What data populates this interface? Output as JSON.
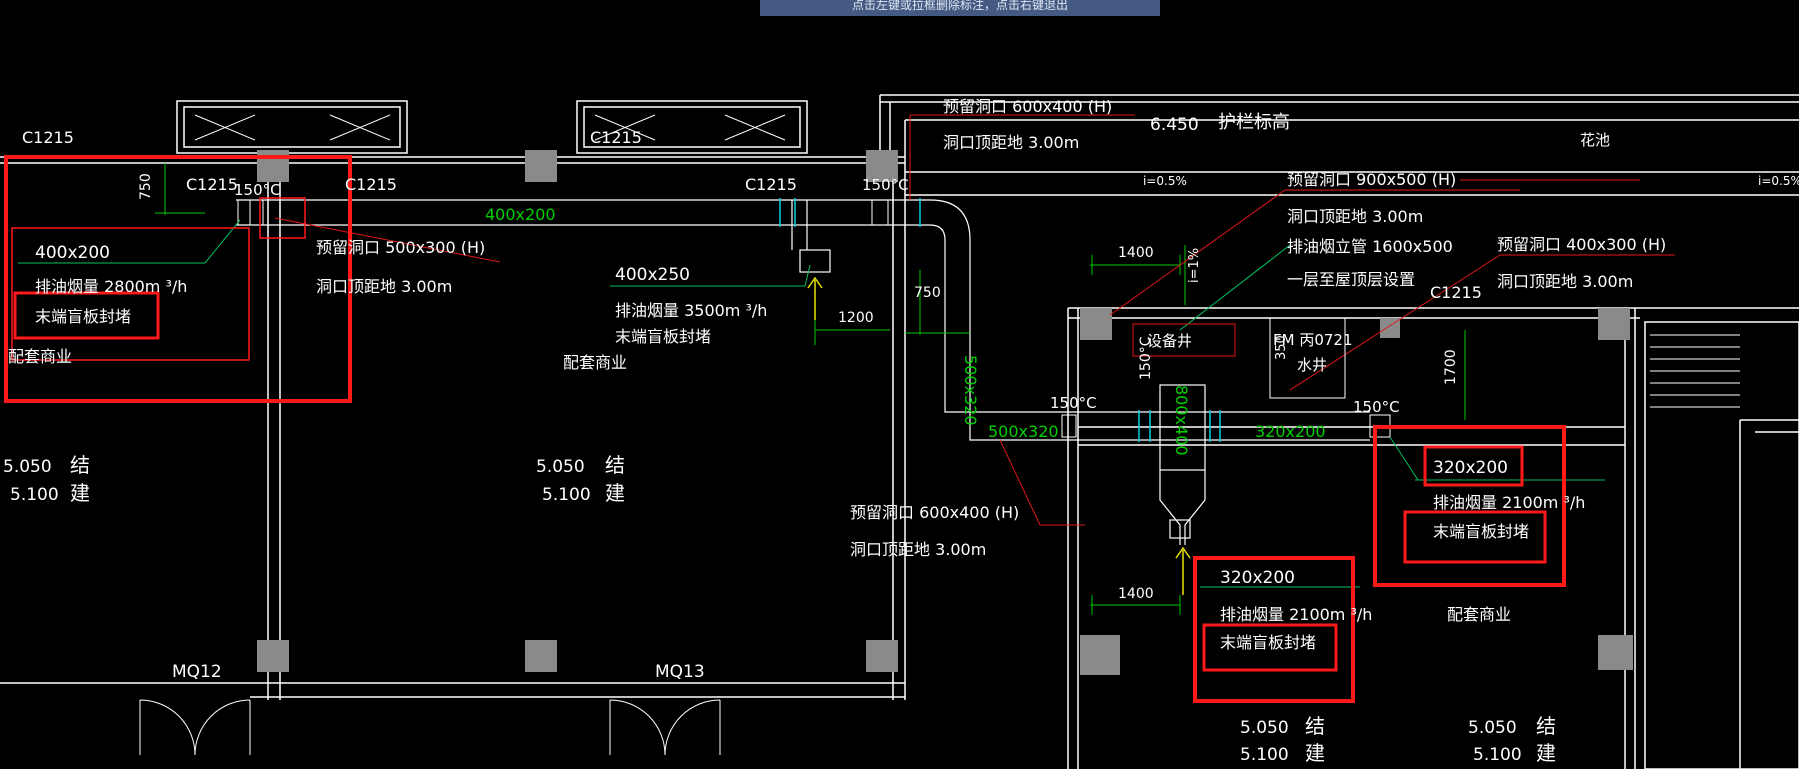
{
  "tooltip": "点击左键或拉框删除标注，点击右键退出",
  "colors": {
    "bg": "#000000",
    "line": "#ffffff",
    "dim": "#00c800",
    "highlight": "#ff0000",
    "grey_col": "#8a8a8a",
    "leader_red": "#e01818",
    "leader_green": "#00c060",
    "yellow": "#e6e600"
  },
  "windows": [
    "C1215",
    "C1215",
    "C1215",
    "C1215",
    "C1215",
    "C1215"
  ],
  "doors": [
    "MQ12",
    "MQ13"
  ],
  "rooms": [
    "配套商业",
    "配套商业",
    "配套商业"
  ],
  "room_partial": "配套商业",
  "shaft": "设备井",
  "shaft2": "水井",
  "fm": "FM 丙0721",
  "elev": {
    "e1": "5.050",
    "e2": "5.100",
    "struct1": "结",
    "struct2": "建",
    "top": "6.450",
    "top_note": "护栏标高",
    "pool": "花池",
    "slope": "i=0.5%",
    "slope2": "i=1%"
  },
  "duct_labels": {
    "d1": "400x200",
    "d2": "500x320",
    "d3": "500x320",
    "d4": "320x200",
    "d5": "800x400"
  },
  "temps": [
    "150°C",
    "150°C",
    "150°C",
    "150°C",
    "150°C"
  ],
  "dims": {
    "a": "750",
    "b": "750",
    "c": "1200",
    "d": "1400",
    "e": "1400",
    "f": "1700",
    "g": "350"
  },
  "notes": [
    {
      "size": "400x200",
      "flow": "排油烟量  2800m  ³/h",
      "cap": "末端盲板封堵"
    },
    {
      "size": "400x250",
      "flow": "排油烟量  3500m  ³/h",
      "cap": "末端盲板封堵"
    },
    {
      "size": "320x200",
      "flow": "排油烟量  2100m  ³/h",
      "cap": "末端盲板封堵"
    },
    {
      "size": "320x200",
      "flow": "排油烟量  2100m  ³/h",
      "cap": "末端盲板封堵"
    }
  ],
  "openings": [
    {
      "label": "预留洞口  500x300  (H)",
      "height": "洞口顶距地  3.00m"
    },
    {
      "label": "预留洞口  600x400  (H)",
      "height": "洞口顶距地  3.00m"
    },
    {
      "label": "预留洞口  900x500  (H)",
      "height": "洞口顶距地  3.00m"
    },
    {
      "label": "预留洞口  400x300  (H)",
      "height": "洞口顶距地  3.00m"
    },
    {
      "label": "预留洞口  600x400  (H)",
      "height": "洞口顶距地  3.00m"
    }
  ],
  "riser": {
    "label": "排油烟立管  1600x500",
    "note": "一层至屋顶层设置"
  }
}
